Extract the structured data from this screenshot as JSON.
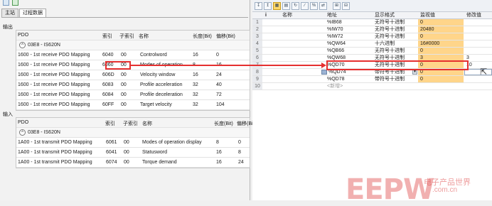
{
  "tabs": [
    "主站",
    "过程数据"
  ],
  "output": {
    "section_label": "输出",
    "headers": [
      "PDO",
      "索引",
      "子索引",
      "名称",
      "长度(Bit)",
      "偏移(Bit)"
    ],
    "device": "03E8 - IS620N",
    "rows": [
      {
        "pdo": "1600 - 1st receive PDO Mapping",
        "index": "6040",
        "sub": "00",
        "name": "Controlword",
        "len": "16",
        "off": "0"
      },
      {
        "pdo": "1600 - 1st receive PDO Mapping",
        "index": "6060",
        "sub": "00",
        "name": "Modes of operation",
        "len": "8",
        "off": "16"
      },
      {
        "pdo": "1600 - 1st receive PDO Mapping",
        "index": "606D",
        "sub": "00",
        "name": "Velocity window",
        "len": "16",
        "off": "24"
      },
      {
        "pdo": "1600 - 1st receive PDO Mapping",
        "index": "6083",
        "sub": "00",
        "name": "Profile acceleration",
        "len": "32",
        "off": "40"
      },
      {
        "pdo": "1600 - 1st receive PDO Mapping",
        "index": "6084",
        "sub": "00",
        "name": "Profile deceleration",
        "len": "32",
        "off": "72"
      },
      {
        "pdo": "1600 - 1st receive PDO Mapping",
        "index": "60FF",
        "sub": "00",
        "name": "Target velocity",
        "len": "32",
        "off": "104"
      }
    ]
  },
  "input": {
    "section_label": "输入",
    "headers": [
      "PDO",
      "索引",
      "子索引",
      "名称",
      "长度(Bit)",
      "偏移(Bit"
    ],
    "device": "03E8 - IS620N",
    "rows": [
      {
        "pdo": "1A00 - 1st transmit PDO Mapping",
        "index": "6061",
        "sub": "00",
        "name": "Modes of operation display",
        "len": "8",
        "off": "0"
      },
      {
        "pdo": "1A00 - 1st transmit PDO Mapping",
        "index": "6041",
        "sub": "00",
        "name": "Statusword",
        "len": "16",
        "off": "8"
      },
      {
        "pdo": "1A00 - 1st transmit PDO Mapping",
        "index": "6074",
        "sub": "00",
        "name": "Torque demand",
        "len": "16",
        "off": "24"
      }
    ]
  },
  "watch": {
    "headers": {
      "info": "i",
      "name": "名称",
      "address": "地址",
      "format": "显示格式",
      "monitor": "监视值",
      "modify": "修改值"
    },
    "rows": [
      {
        "n": "1",
        "address": "%IB68",
        "format": "无符号十进制",
        "monitor": "0",
        "modify": ""
      },
      {
        "n": "2",
        "address": "%IW70",
        "format": "无符号十进制",
        "monitor": "20480",
        "modify": ""
      },
      {
        "n": "3",
        "address": "%IW72",
        "format": "无符号十进制",
        "monitor": "0",
        "modify": ""
      },
      {
        "n": "4",
        "address": "%QW64",
        "format": "十六进制",
        "monitor": "16#0000",
        "modify": ""
      },
      {
        "n": "5",
        "address": "%QB66",
        "format": "无符号十进制",
        "monitor": "0",
        "modify": ""
      },
      {
        "n": "6",
        "address": "%QW68",
        "format": "无符号十进制",
        "monitor": "3",
        "modify": "3"
      },
      {
        "n": "7",
        "address": "%QD70",
        "format": "无符号十进制",
        "monitor": "0",
        "modify": "10"
      },
      {
        "n": "8",
        "address": "%QD74",
        "format": "带符号十进制",
        "monitor": "0",
        "modify": ""
      },
      {
        "n": "9",
        "address": "%QD78",
        "format": "带符号十进制",
        "monitor": "0",
        "modify": ""
      },
      {
        "n": "10",
        "address": "<新增>",
        "format": "",
        "monitor": "",
        "modify": ""
      }
    ]
  },
  "watermark": {
    "main": "EEPW",
    "cn": "电子产品世界",
    "url": ".com.cn"
  },
  "colors": {
    "highlight": "#e53030",
    "monitor_bg": "#ffd58a"
  }
}
